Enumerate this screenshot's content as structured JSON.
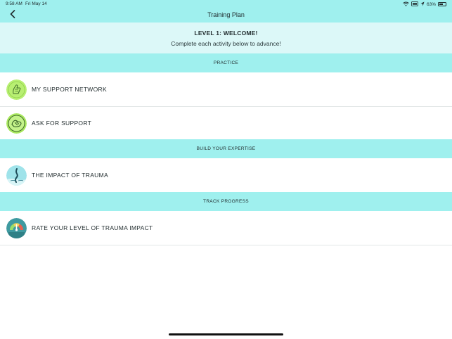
{
  "status_bar": {
    "time": "9:58 AM",
    "date": "Fri May 14",
    "battery_text": "63%",
    "battery_level": 0.63
  },
  "nav": {
    "title": "Training Plan",
    "back_icon": "chevron-left-icon"
  },
  "level": {
    "title": "LEVEL 1: WELCOME!",
    "subtitle": "Complete each activity below to advance!"
  },
  "sections": [
    {
      "header": "PRACTICE",
      "items": [
        {
          "label": "MY SUPPORT NETWORK",
          "icon": "support-network-icon"
        },
        {
          "label": "ASK FOR SUPPORT",
          "icon": "ask-support-icon"
        }
      ]
    },
    {
      "header": "BUILD YOUR EXPERTISE",
      "items": [
        {
          "label": "THE IMPACT OF TRAUMA",
          "icon": "trauma-impact-icon"
        }
      ]
    },
    {
      "header": "TRACK PROGRESS",
      "items": [
        {
          "label": "RATE YOUR LEVEL OF TRAUMA IMPACT",
          "icon": "gauge-icon"
        }
      ]
    }
  ],
  "colors": {
    "header_teal": "#9ff0ee",
    "level_bg": "#dcf8f8",
    "icon_green": "#b8ef72",
    "icon_teal": "#7fd6e0"
  }
}
